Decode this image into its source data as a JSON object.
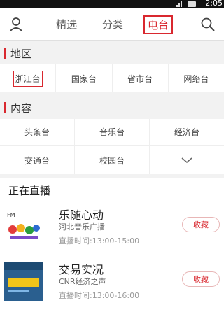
{
  "status": {
    "time": "2:05"
  },
  "nav": {
    "tabs": [
      {
        "label": "精选"
      },
      {
        "label": "分类"
      },
      {
        "label": "电台"
      }
    ]
  },
  "region": {
    "title": "地区",
    "items": [
      "浙江台",
      "国家台",
      "省市台",
      "网络台"
    ]
  },
  "content": {
    "title": "内容",
    "row1": [
      "头条台",
      "音乐台",
      "经济台"
    ],
    "row2": [
      "交通台",
      "校园台"
    ]
  },
  "live": {
    "title": "正在直播",
    "items": [
      {
        "name": "乐随心动",
        "station": "河北音乐广播",
        "time": "直播时间:13:00-15:00",
        "fav": "收藏"
      },
      {
        "name": "交易实况",
        "station": "CNR经济之声",
        "time": "直播时间:13:00-16:00",
        "fav": "收藏"
      }
    ]
  },
  "colors": {
    "accent": "#d9282f"
  }
}
